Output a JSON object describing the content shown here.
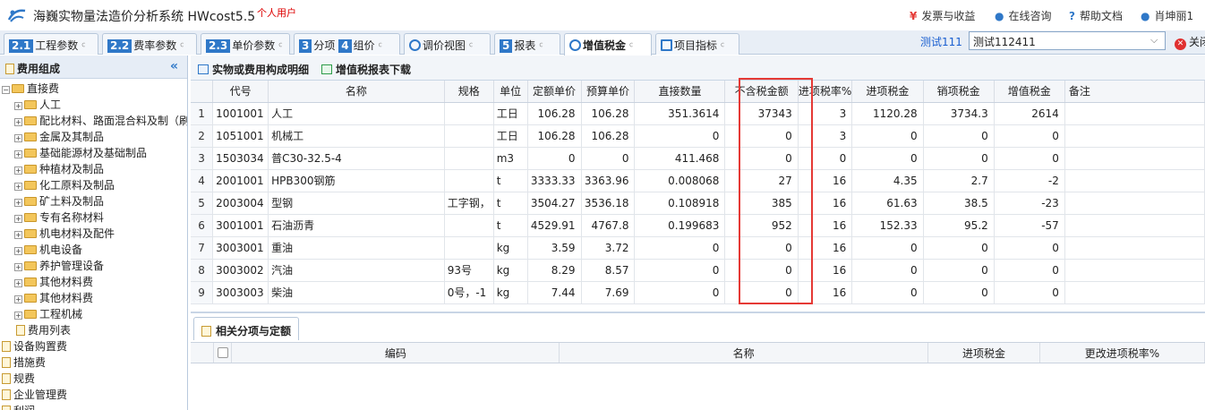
{
  "app": {
    "title": "海巍实物量法造价分析系统 HWcost5.5",
    "user_type": "个人用户",
    "links": [
      {
        "icon": "¥",
        "label": "发票与收益"
      },
      {
        "icon": "●",
        "label": "在线咨询"
      },
      {
        "icon": "?",
        "label": "帮助文档"
      },
      {
        "icon": "●",
        "label": "肖坤丽1"
      }
    ]
  },
  "tabs": [
    {
      "num": "2.1",
      "label": "工程参数"
    },
    {
      "num": "2.2",
      "label": "费率参数"
    },
    {
      "num": "2.3",
      "label": "单价参数"
    },
    {
      "num": "3",
      "label": "分项",
      "num2": "4",
      "label2": "组价"
    },
    {
      "label": "调价视图"
    },
    {
      "num": "5",
      "label": "报表"
    },
    {
      "label": "增值税金"
    },
    {
      "label": "项目指标"
    }
  ],
  "project": {
    "label": "测试111",
    "value": "测试112411",
    "close_label": "关闭"
  },
  "left": {
    "header": "费用组成",
    "tree": [
      {
        "label": "直接费",
        "level": 0,
        "kind": "folder-open"
      },
      {
        "label": "人工",
        "level": 1,
        "kind": "folder"
      },
      {
        "label": "配比材料、路面混合料及制（刷",
        "level": 1,
        "kind": "folder"
      },
      {
        "label": "金属及其制品",
        "level": 1,
        "kind": "folder"
      },
      {
        "label": "基础能源材及基础制品",
        "level": 1,
        "kind": "folder"
      },
      {
        "label": "种植材及制品",
        "level": 1,
        "kind": "folder"
      },
      {
        "label": "化工原料及制品",
        "level": 1,
        "kind": "folder"
      },
      {
        "label": "矿土料及制品",
        "level": 1,
        "kind": "folder"
      },
      {
        "label": "专有名称材料",
        "level": 1,
        "kind": "folder"
      },
      {
        "label": "机电材料及配件",
        "level": 1,
        "kind": "folder"
      },
      {
        "label": "机电设备",
        "level": 1,
        "kind": "folder"
      },
      {
        "label": "养护管理设备",
        "level": 1,
        "kind": "folder"
      },
      {
        "label": "其他材料费",
        "level": 1,
        "kind": "folder"
      },
      {
        "label": "其他材料费",
        "level": 1,
        "kind": "folder"
      },
      {
        "label": "工程机械",
        "level": 1,
        "kind": "folder"
      },
      {
        "label": "费用列表",
        "level": 2,
        "kind": "doc"
      },
      {
        "label": "设备购置费",
        "level": 0,
        "kind": "doc"
      },
      {
        "label": "措施费",
        "level": 0,
        "kind": "doc"
      },
      {
        "label": "规费",
        "level": 0,
        "kind": "doc"
      },
      {
        "label": "企业管理费",
        "level": 0,
        "kind": "doc"
      },
      {
        "label": "利润",
        "level": 0,
        "kind": "doc"
      }
    ]
  },
  "toolbar": {
    "detail": "实物或费用构成明细",
    "download": "增值税报表下载"
  },
  "grid": {
    "headers": [
      "",
      "代号",
      "名称",
      "规格",
      "单位",
      "定额单价",
      "预算单价",
      "直接数量",
      "不含税金额",
      "进项税率%",
      "进项税金",
      "销项税金",
      "增值税金",
      "备注"
    ],
    "rows": [
      [
        "1",
        "1001001",
        "人工",
        "",
        "工日",
        "106.28",
        "106.28",
        "351.3614",
        "37343",
        "3",
        "1120.28",
        "3734.3",
        "2614",
        ""
      ],
      [
        "2",
        "1051001",
        "机械工",
        "",
        "工日",
        "106.28",
        "106.28",
        "0",
        "0",
        "3",
        "0",
        "0",
        "0",
        ""
      ],
      [
        "3",
        "1503034",
        "普C30-32.5-4",
        "",
        "m3",
        "0",
        "0",
        "411.468",
        "0",
        "0",
        "0",
        "0",
        "0",
        ""
      ],
      [
        "4",
        "2001001",
        "HPB300钢筋",
        "",
        "t",
        "3333.33",
        "3363.96",
        "0.008068",
        "27",
        "16",
        "4.35",
        "2.7",
        "-2",
        ""
      ],
      [
        "5",
        "2003004",
        "型钢",
        "工字钢，",
        "t",
        "3504.27",
        "3536.18",
        "0.108918",
        "385",
        "16",
        "61.63",
        "38.5",
        "-23",
        ""
      ],
      [
        "6",
        "3001001",
        "石油沥青",
        "",
        "t",
        "4529.91",
        "4767.8",
        "0.199683",
        "952",
        "16",
        "152.33",
        "95.2",
        "-57",
        ""
      ],
      [
        "7",
        "3003001",
        "重油",
        "",
        "kg",
        "3.59",
        "3.72",
        "0",
        "0",
        "16",
        "0",
        "0",
        "0",
        ""
      ],
      [
        "8",
        "3003002",
        "汽油",
        "93号",
        "kg",
        "8.29",
        "8.57",
        "0",
        "0",
        "16",
        "0",
        "0",
        "0",
        ""
      ],
      [
        "9",
        "3003003",
        "柴油",
        "0号，-1",
        "kg",
        "7.44",
        "7.69",
        "0",
        "0",
        "16",
        "0",
        "0",
        "0",
        ""
      ]
    ]
  },
  "bottom": {
    "tab": "相关分项与定额",
    "headers": [
      "",
      "编码",
      "名称",
      "进项税金",
      "更改进项税率%"
    ]
  },
  "colors": {
    "accent": "#2f78c8",
    "highlight": "#e53935"
  }
}
